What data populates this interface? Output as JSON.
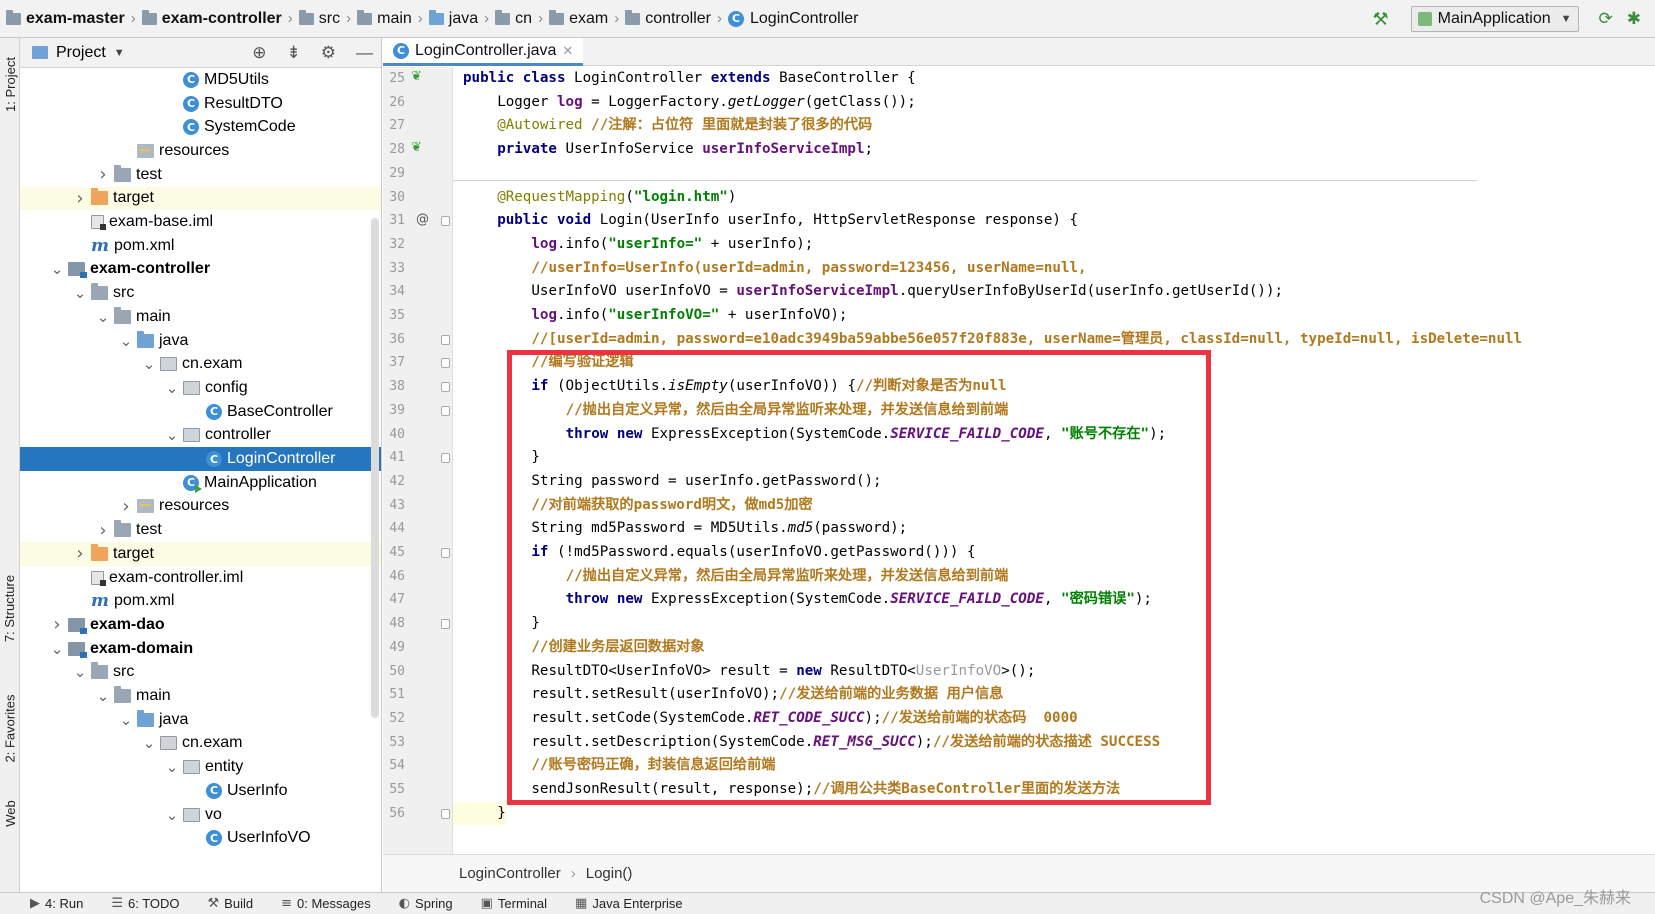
{
  "breadcrumb": [
    "exam-master",
    "exam-controller",
    "src",
    "main",
    "java",
    "cn",
    "exam",
    "controller",
    "LoginController"
  ],
  "run_config": "MainApplication",
  "project_panel": {
    "title": "Project"
  },
  "tree": [
    {
      "label": "MD5Utils",
      "depth": 7,
      "icon": "class",
      "arrow": ""
    },
    {
      "label": "ResultDTO",
      "depth": 7,
      "icon": "class",
      "arrow": ""
    },
    {
      "label": "SystemCode",
      "depth": 7,
      "icon": "class",
      "arrow": ""
    },
    {
      "label": "resources",
      "depth": 5,
      "icon": "resources",
      "arrow": ""
    },
    {
      "label": "test",
      "depth": 4,
      "icon": "folder",
      "arrow": "collapsed"
    },
    {
      "label": "target",
      "depth": 3,
      "icon": "folder-orange",
      "arrow": "collapsed",
      "highlight": true
    },
    {
      "label": "exam-base.iml",
      "depth": 3,
      "icon": "iml",
      "arrow": ""
    },
    {
      "label": "pom.xml",
      "depth": 3,
      "icon": "maven",
      "arrow": ""
    },
    {
      "label": "exam-controller",
      "depth": 2,
      "icon": "module",
      "arrow": "expanded",
      "bold": true
    },
    {
      "label": "src",
      "depth": 3,
      "icon": "folder",
      "arrow": "expanded"
    },
    {
      "label": "main",
      "depth": 4,
      "icon": "folder",
      "arrow": "expanded"
    },
    {
      "label": "java",
      "depth": 5,
      "icon": "folder-blue",
      "arrow": "expanded"
    },
    {
      "label": "cn.exam",
      "depth": 6,
      "icon": "package",
      "arrow": "expanded"
    },
    {
      "label": "config",
      "depth": 7,
      "icon": "package",
      "arrow": "expanded"
    },
    {
      "label": "BaseController",
      "depth": 8,
      "icon": "class",
      "arrow": ""
    },
    {
      "label": "controller",
      "depth": 7,
      "icon": "package",
      "arrow": "expanded"
    },
    {
      "label": "LoginController",
      "depth": 8,
      "icon": "class",
      "arrow": "",
      "selected": true
    },
    {
      "label": "MainApplication",
      "depth": 7,
      "icon": "class-run",
      "arrow": ""
    },
    {
      "label": "resources",
      "depth": 5,
      "icon": "resources",
      "arrow": "collapsed"
    },
    {
      "label": "test",
      "depth": 4,
      "icon": "folder",
      "arrow": "collapsed"
    },
    {
      "label": "target",
      "depth": 3,
      "icon": "folder-orange",
      "arrow": "collapsed",
      "highlight": true
    },
    {
      "label": "exam-controller.iml",
      "depth": 3,
      "icon": "iml",
      "arrow": ""
    },
    {
      "label": "pom.xml",
      "depth": 3,
      "icon": "maven",
      "arrow": ""
    },
    {
      "label": "exam-dao",
      "depth": 2,
      "icon": "module",
      "arrow": "collapsed",
      "bold": true
    },
    {
      "label": "exam-domain",
      "depth": 2,
      "icon": "module",
      "arrow": "expanded",
      "bold": true
    },
    {
      "label": "src",
      "depth": 3,
      "icon": "folder",
      "arrow": "expanded"
    },
    {
      "label": "main",
      "depth": 4,
      "icon": "folder",
      "arrow": "expanded"
    },
    {
      "label": "java",
      "depth": 5,
      "icon": "folder-blue",
      "arrow": "expanded"
    },
    {
      "label": "cn.exam",
      "depth": 6,
      "icon": "package",
      "arrow": "expanded"
    },
    {
      "label": "entity",
      "depth": 7,
      "icon": "package",
      "arrow": "expanded"
    },
    {
      "label": "UserInfo",
      "depth": 8,
      "icon": "class",
      "arrow": ""
    },
    {
      "label": "vo",
      "depth": 7,
      "icon": "package",
      "arrow": "expanded"
    },
    {
      "label": "UserInfoVO",
      "depth": 8,
      "icon": "class",
      "arrow": ""
    }
  ],
  "editor": {
    "tab_label": "LoginController.java",
    "lines": [
      {
        "n": "25",
        "marker": "leaf",
        "fold": false,
        "indent": 0,
        "tokens": [
          [
            "kw",
            "public class "
          ],
          [
            "",
            "LoginController "
          ],
          [
            "kw",
            "extends "
          ],
          [
            "",
            "BaseController {"
          ]
        ]
      },
      {
        "n": "26",
        "marker": "",
        "fold": false,
        "indent": 1,
        "tokens": [
          [
            "",
            "Logger "
          ],
          [
            "fld",
            "log"
          ],
          [
            "",
            " = LoggerFactory."
          ],
          [
            "mi",
            "getLogger"
          ],
          [
            "",
            "(getClass());"
          ]
        ]
      },
      {
        "n": "27",
        "marker": "",
        "fold": false,
        "indent": 1,
        "tokens": [
          [
            "ann",
            "@Autowired "
          ],
          [
            "cmz",
            "//注解：占位符 里面就是封装了很多的代码"
          ]
        ]
      },
      {
        "n": "28",
        "marker": "leaf",
        "fold": false,
        "indent": 1,
        "tokens": [
          [
            "kw",
            "private "
          ],
          [
            "",
            "UserInfoService "
          ],
          [
            "fld",
            "userInfoServiceImpl"
          ],
          [
            "",
            ";"
          ]
        ]
      },
      {
        "n": "29",
        "marker": "",
        "fold": false,
        "indent": 0,
        "tokens": []
      },
      {
        "n": "30",
        "marker": "",
        "fold": false,
        "indent": 1,
        "tokens": [
          [
            "ann",
            "@RequestMapping"
          ],
          [
            "",
            "("
          ],
          [
            "str",
            "\"login.htm\""
          ],
          [
            "",
            ")"
          ]
        ]
      },
      {
        "n": "31",
        "marker": "at",
        "fold": true,
        "indent": 1,
        "tokens": [
          [
            "kw",
            "public void "
          ],
          [
            "",
            "Login(UserInfo userInfo, HttpServletResponse response) {"
          ]
        ]
      },
      {
        "n": "32",
        "marker": "",
        "fold": false,
        "indent": 2,
        "tokens": [
          [
            "fld",
            "log"
          ],
          [
            "",
            ".info("
          ],
          [
            "str",
            "\"userInfo=\""
          ],
          [
            "",
            " + userInfo);"
          ]
        ]
      },
      {
        "n": "33",
        "marker": "",
        "fold": false,
        "indent": 2,
        "tokens": [
          [
            "cmz",
            "//userInfo=UserInfo(userId=admin, password=123456, userName=null,"
          ]
        ]
      },
      {
        "n": "34",
        "marker": "",
        "fold": false,
        "indent": 2,
        "tokens": [
          [
            "",
            "UserInfoVO userInfoVO = "
          ],
          [
            "fld",
            "userInfoServiceImpl"
          ],
          [
            "",
            ".queryUserInfoByUserId(userInfo.getUserId());"
          ]
        ]
      },
      {
        "n": "35",
        "marker": "",
        "fold": false,
        "indent": 2,
        "tokens": [
          [
            "fld",
            "log"
          ],
          [
            "",
            ".info("
          ],
          [
            "str",
            "\"userInfoVO=\""
          ],
          [
            "",
            " + userInfoVO);"
          ]
        ]
      },
      {
        "n": "36",
        "marker": "",
        "fold": true,
        "indent": 2,
        "tokens": [
          [
            "cmz",
            "//[userId=admin, password=e10adc3949ba59abbe56e057f20f883e, userName=管理员, classId=null, typeId=null, isDelete=null"
          ]
        ]
      },
      {
        "n": "37",
        "marker": "",
        "fold": true,
        "indent": 2,
        "tokens": [
          [
            "cmz",
            "//编写验证逻辑"
          ]
        ]
      },
      {
        "n": "38",
        "marker": "",
        "fold": true,
        "indent": 2,
        "tokens": [
          [
            "kw",
            "if "
          ],
          [
            "",
            "(ObjectUtils."
          ],
          [
            "mi",
            "isEmpty"
          ],
          [
            "",
            "(userInfoVO)) {"
          ],
          [
            "cmz",
            "//判断对象是否为null"
          ]
        ]
      },
      {
        "n": "39",
        "marker": "",
        "fold": true,
        "indent": 3,
        "tokens": [
          [
            "cmz",
            "//抛出自定义异常，然后由全局异常监听来处理，并发送信息给到前端"
          ]
        ]
      },
      {
        "n": "40",
        "marker": "",
        "fold": false,
        "indent": 3,
        "tokens": [
          [
            "kw",
            "throw new "
          ],
          [
            "",
            "ExpressException(SystemCode."
          ],
          [
            "st",
            "SERVICE_FAILD_CODE"
          ],
          [
            "",
            ", "
          ],
          [
            "str",
            "\"账号不存在\""
          ],
          [
            "",
            ");"
          ]
        ]
      },
      {
        "n": "41",
        "marker": "",
        "fold": true,
        "indent": 2,
        "tokens": [
          [
            "",
            "}"
          ]
        ]
      },
      {
        "n": "42",
        "marker": "",
        "fold": false,
        "indent": 2,
        "tokens": [
          [
            "",
            "String password = userInfo.getPassword();"
          ]
        ]
      },
      {
        "n": "43",
        "marker": "",
        "fold": false,
        "indent": 2,
        "tokens": [
          [
            "cmz",
            "//对前端获取的password明文，做md5加密"
          ]
        ]
      },
      {
        "n": "44",
        "marker": "",
        "fold": false,
        "indent": 2,
        "tokens": [
          [
            "",
            "String md5Password = MD5Utils."
          ],
          [
            "mi",
            "md5"
          ],
          [
            "",
            "(password);"
          ]
        ]
      },
      {
        "n": "45",
        "marker": "",
        "fold": true,
        "indent": 2,
        "tokens": [
          [
            "kw",
            "if "
          ],
          [
            "",
            "(!md5Password.equals(userInfoVO.getPassword())) {"
          ]
        ]
      },
      {
        "n": "46",
        "marker": "",
        "fold": false,
        "indent": 3,
        "tokens": [
          [
            "cmz",
            "//抛出自定义异常，然后由全局异常监听来处理，并发送信息给到前端"
          ]
        ]
      },
      {
        "n": "47",
        "marker": "",
        "fold": false,
        "indent": 3,
        "tokens": [
          [
            "kw",
            "throw new "
          ],
          [
            "",
            "ExpressException(SystemCode."
          ],
          [
            "st",
            "SERVICE_FAILD_CODE"
          ],
          [
            "",
            ", "
          ],
          [
            "str",
            "\"密码错误\""
          ],
          [
            "",
            ");"
          ]
        ]
      },
      {
        "n": "48",
        "marker": "",
        "fold": true,
        "indent": 2,
        "tokens": [
          [
            "",
            "}"
          ]
        ]
      },
      {
        "n": "49",
        "marker": "",
        "fold": false,
        "indent": 2,
        "tokens": [
          [
            "cmz",
            "//创建业务层返回数据对象"
          ]
        ]
      },
      {
        "n": "50",
        "marker": "",
        "fold": false,
        "indent": 2,
        "tokens": [
          [
            "",
            "ResultDTO<UserInfoVO> result = "
          ],
          [
            "kw",
            "new "
          ],
          [
            "",
            "ResultDTO<"
          ],
          [
            "gen",
            "UserInfoVO"
          ],
          [
            "",
            ">();"
          ]
        ]
      },
      {
        "n": "51",
        "marker": "",
        "fold": false,
        "indent": 2,
        "tokens": [
          [
            "",
            "result.setResult(userInfoVO);"
          ],
          [
            "cmz",
            "//发送给前端的业务数据 用户信息"
          ]
        ]
      },
      {
        "n": "52",
        "marker": "",
        "fold": false,
        "indent": 2,
        "tokens": [
          [
            "",
            "result.setCode(SystemCode."
          ],
          [
            "st",
            "RET_CODE_SUCC"
          ],
          [
            "",
            ");"
          ],
          [
            "cmz",
            "//发送给前端的状态码  0000"
          ]
        ]
      },
      {
        "n": "53",
        "marker": "",
        "fold": false,
        "indent": 2,
        "tokens": [
          [
            "",
            "result.setDescription(SystemCode."
          ],
          [
            "st",
            "RET_MSG_SUCC"
          ],
          [
            "",
            ");"
          ],
          [
            "cmz",
            "//发送给前端的状态描述 SUCCESS"
          ]
        ]
      },
      {
        "n": "54",
        "marker": "",
        "fold": false,
        "indent": 2,
        "tokens": [
          [
            "cmz",
            "//账号密码正确，封装信息返回给前端"
          ]
        ]
      },
      {
        "n": "55",
        "marker": "",
        "fold": false,
        "indent": 2,
        "tokens": [
          [
            "",
            "sendJsonResult(result, response);"
          ],
          [
            "cmz",
            "//调用公共类BaseController里面的发送方法"
          ]
        ]
      },
      {
        "n": "56",
        "marker": "",
        "fold": true,
        "indent": 1,
        "cur": true,
        "tokens": [
          [
            "",
            "}"
          ]
        ]
      }
    ]
  },
  "editor_footer": [
    "LoginController",
    "Login()"
  ],
  "left_tabs": [
    "1: Project",
    "7: Structure",
    "2: Favorites",
    "Web"
  ],
  "bottom_tabs": [
    {
      "icon": "▶",
      "label": "4: Run"
    },
    {
      "icon": "☰",
      "label": "6: TODO"
    },
    {
      "icon": "⚒",
      "label": "Build"
    },
    {
      "icon": "≡",
      "label": "0: Messages"
    },
    {
      "icon": "◐",
      "label": "Spring"
    },
    {
      "icon": "▣",
      "label": "Terminal"
    },
    {
      "icon": "▦",
      "label": "Java Enterprise"
    }
  ],
  "watermark": "CSDN @Ape_朱赫来",
  "colors": {
    "selection": "#2675bf",
    "highlight_box": "#ed3340"
  }
}
